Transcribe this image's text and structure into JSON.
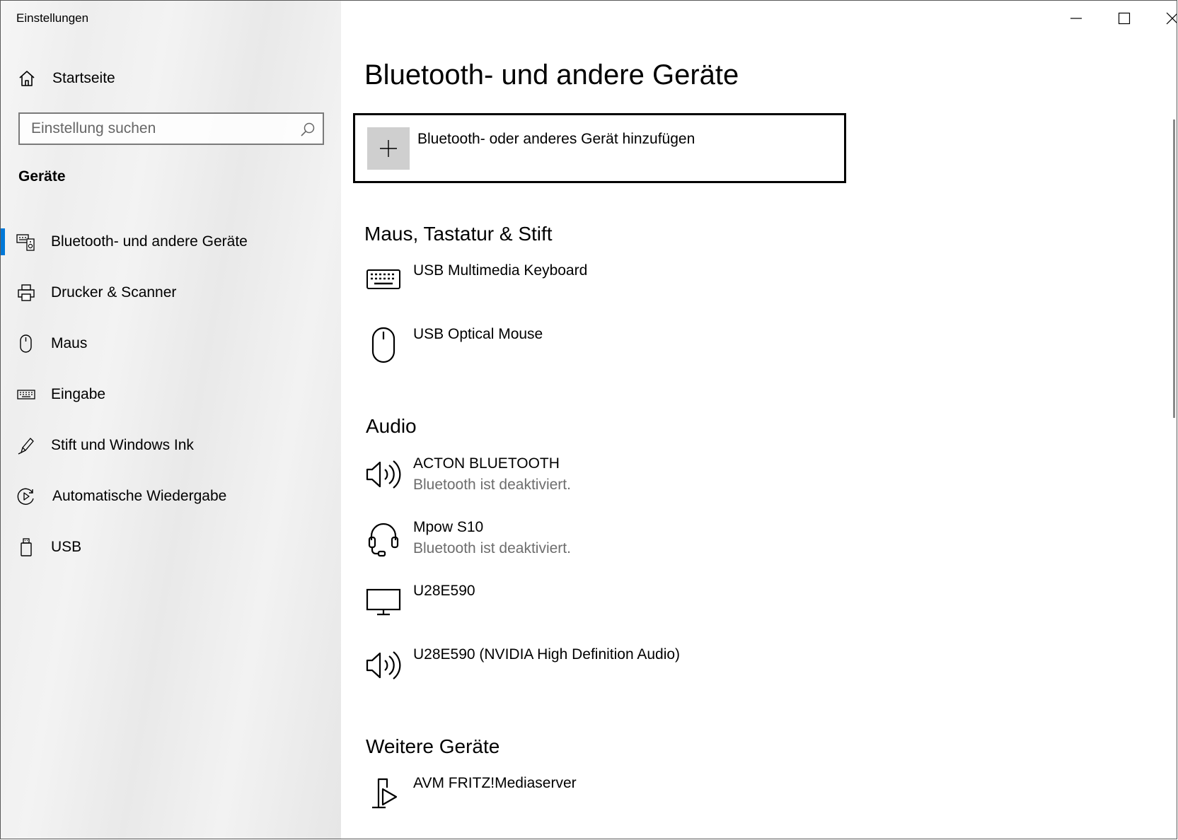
{
  "window": {
    "title": "Einstellungen"
  },
  "sidebar": {
    "home_label": "Startseite",
    "search_placeholder": "Einstellung suchen",
    "section": "Geräte",
    "items": [
      {
        "label": "Bluetooth- und andere Geräte",
        "icon": "devices-icon",
        "active": true
      },
      {
        "label": "Drucker & Scanner",
        "icon": "printer-icon"
      },
      {
        "label": "Maus",
        "icon": "mouse-icon"
      },
      {
        "label": "Eingabe",
        "icon": "keyboard-icon"
      },
      {
        "label": "Stift und Windows Ink",
        "icon": "pen-icon"
      },
      {
        "label": "Automatische Wiedergabe",
        "icon": "autoplay-icon"
      },
      {
        "label": "USB",
        "icon": "usb-icon"
      }
    ]
  },
  "main": {
    "title": "Bluetooth- und andere Geräte",
    "add_device_label": "Bluetooth- oder anderes Gerät hinzufügen",
    "groups": [
      {
        "title": "Maus, Tastatur & Stift",
        "devices": [
          {
            "name": "USB Multimedia Keyboard",
            "icon": "keyboard-icon"
          },
          {
            "name": "USB Optical Mouse",
            "icon": "mouse-icon"
          }
        ]
      },
      {
        "title": "Audio",
        "devices": [
          {
            "name": "ACTON BLUETOOTH",
            "status": "Bluetooth ist deaktiviert.",
            "icon": "speaker-icon"
          },
          {
            "name": "Mpow S10",
            "status": "Bluetooth ist deaktiviert.",
            "icon": "headset-icon"
          },
          {
            "name": "U28E590",
            "icon": "monitor-icon"
          },
          {
            "name": "U28E590 (NVIDIA High Definition Audio)",
            "icon": "speaker-icon"
          }
        ]
      },
      {
        "title": "Weitere Geräte",
        "devices": [
          {
            "name": "AVM FRITZ!Mediaserver",
            "icon": "media-server-icon"
          }
        ]
      }
    ]
  },
  "colors": {
    "accent": "#0078d7",
    "status_text": "#6d6d6d",
    "add_tile": "#cfcfcf"
  }
}
